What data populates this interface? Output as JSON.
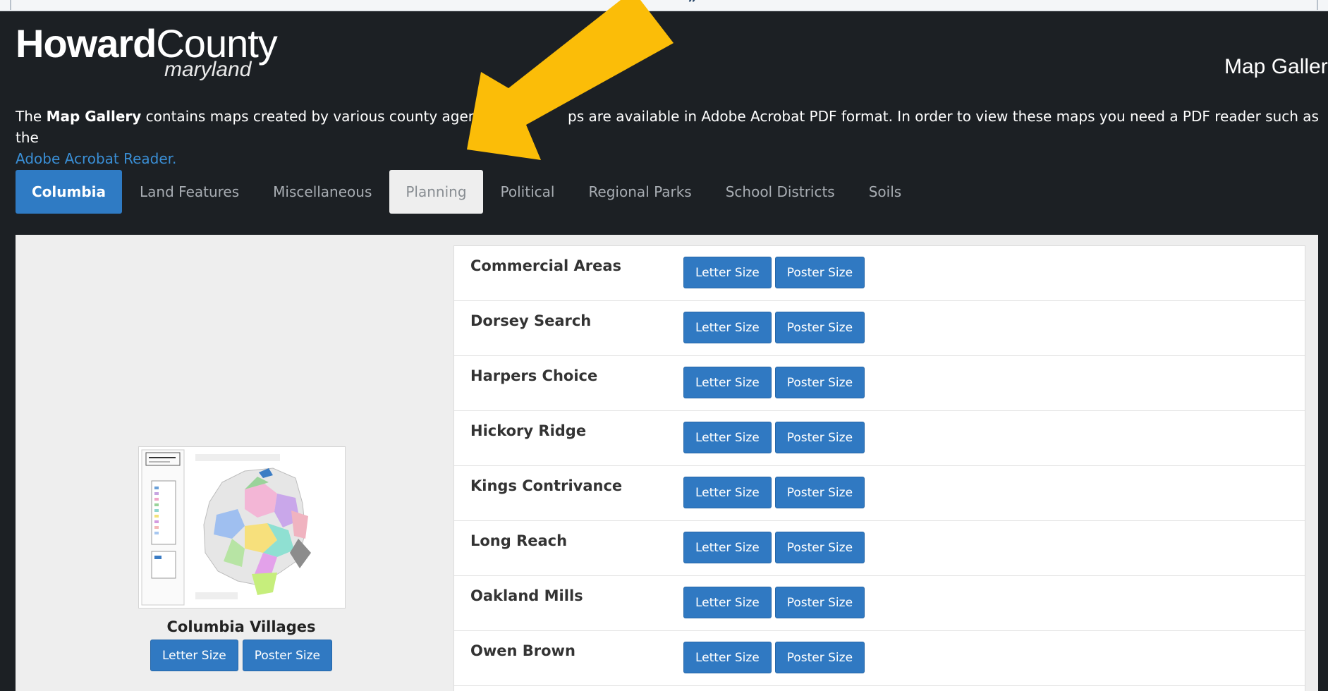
{
  "header": {
    "logo_strong": "Howard",
    "logo_rest": "County",
    "logo_sub": "maryland",
    "page_title": "Map Galler"
  },
  "intro": {
    "prefix": "The ",
    "bold": "Map Gallery",
    "text_a": " contains maps created by various county agenci",
    "text_b": "ps are available in Adobe Acrobat PDF format. In order to view these maps you need a PDF reader such as the",
    "link": "Adobe Acrobat Reader."
  },
  "tabs": [
    {
      "label": "Columbia",
      "state": "active"
    },
    {
      "label": "Land Features",
      "state": "normal"
    },
    {
      "label": "Miscellaneous",
      "state": "normal"
    },
    {
      "label": "Planning",
      "state": "highlight"
    },
    {
      "label": "Political",
      "state": "normal"
    },
    {
      "label": "Regional Parks",
      "state": "normal"
    },
    {
      "label": "School Districts",
      "state": "normal"
    },
    {
      "label": "Soils",
      "state": "normal"
    }
  ],
  "preview": {
    "title": "Columbia Villages",
    "letter_label": "Letter Size",
    "poster_label": "Poster Size"
  },
  "maps": [
    {
      "name": "Commercial Areas",
      "letter": "Letter Size",
      "poster": "Poster Size"
    },
    {
      "name": "Dorsey Search",
      "letter": "Letter Size",
      "poster": "Poster Size"
    },
    {
      "name": "Harpers Choice",
      "letter": "Letter Size",
      "poster": "Poster Size"
    },
    {
      "name": "Hickory Ridge",
      "letter": "Letter Size",
      "poster": "Poster Size"
    },
    {
      "name": "Kings Contrivance",
      "letter": "Letter Size",
      "poster": "Poster Size"
    },
    {
      "name": "Long Reach",
      "letter": "Letter Size",
      "poster": "Poster Size"
    },
    {
      "name": "Oakland Mills",
      "letter": "Letter Size",
      "poster": "Poster Size"
    },
    {
      "name": "Owen Brown",
      "letter": "Letter Size",
      "poster": "Poster Size"
    }
  ],
  "colors": {
    "header_bg": "#1c2024",
    "accent_blue": "#2f7bc4",
    "annotation_arrow": "#fbbd08"
  }
}
